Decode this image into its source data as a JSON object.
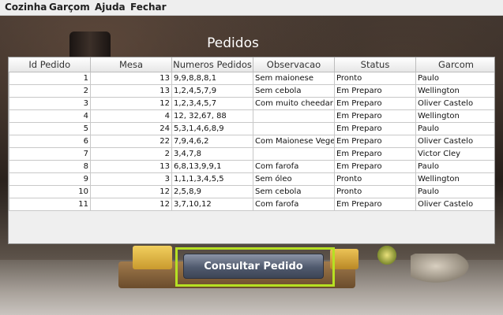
{
  "menu": [
    "Cozinha",
    "Garçom",
    "Ajuda",
    "Fechar"
  ],
  "title": "Pedidos",
  "table": {
    "columns": [
      "Id Pedido",
      "Mesa",
      "Numeros Pedidos",
      "Observacao",
      "Status",
      "Garcom"
    ],
    "rows": [
      [
        "1",
        "13",
        "9,9,8,8,8,1",
        "Sem maionese",
        "Pronto",
        "Paulo"
      ],
      [
        "2",
        "13",
        "1,2,4,5,7,9",
        "Sem cebola",
        "Em Preparo",
        "Wellington"
      ],
      [
        "3",
        "12",
        "1,2,3,4,5,7",
        "Com muito cheedar",
        "Em Preparo",
        "Oliver Castelo"
      ],
      [
        "4",
        "4",
        "12, 32,67, 88",
        "",
        "Em Preparo",
        "Wellington"
      ],
      [
        "5",
        "24",
        "5,3,1,4,6,8,9",
        "",
        "Em Preparo",
        "Paulo"
      ],
      [
        "6",
        "22",
        "7,9,4,6,2",
        "Com Maionese Vegetal",
        "Em Preparo",
        "Oliver Castelo"
      ],
      [
        "7",
        "2",
        "3,4,7,8",
        "",
        "Em Preparo",
        "Victor Cley"
      ],
      [
        "8",
        "13",
        "6,8,13,9,9,1",
        "Com farofa",
        "Em Preparo",
        "Paulo"
      ],
      [
        "9",
        "3",
        "1,1,1,3,4,5,5",
        "Sem óleo",
        "Pronto",
        "Wellington"
      ],
      [
        "10",
        "12",
        "2,5,8,9",
        "Sem cebola",
        "Pronto",
        "Paulo"
      ],
      [
        "11",
        "12",
        "3,7,10,12",
        "Com farofa",
        "Em Preparo",
        "Oliver Castelo"
      ]
    ]
  },
  "button": {
    "label": "Consultar Pedido"
  },
  "colors": {
    "highlight_border": "#b6e023",
    "button_bg": "#505a6e"
  }
}
